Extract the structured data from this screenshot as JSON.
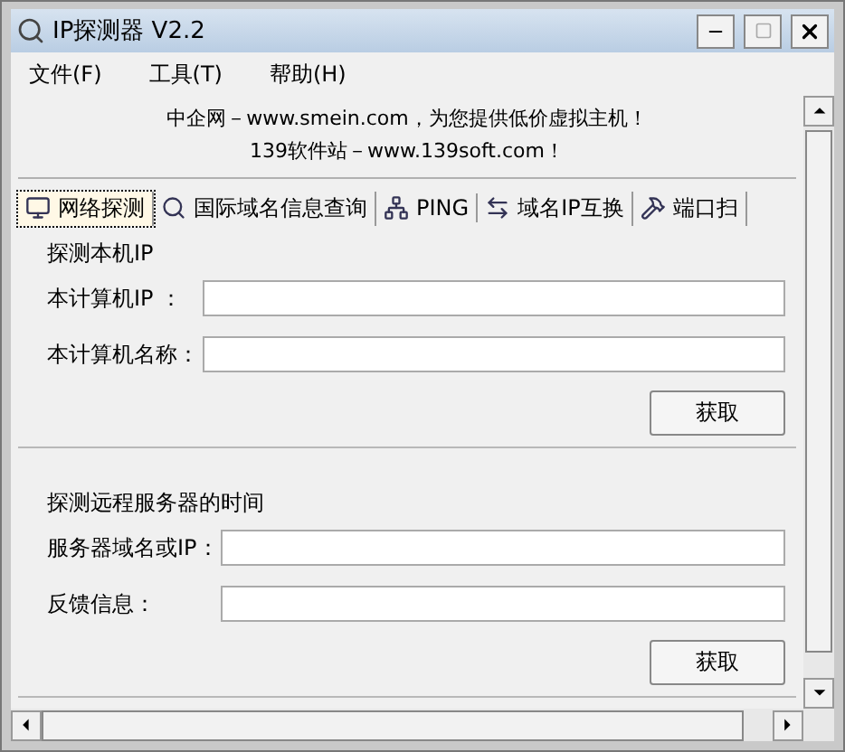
{
  "window": {
    "title": "IP探测器 V2.2"
  },
  "menu": [
    "文件(F)",
    "工具(T)",
    "帮助(H)"
  ],
  "banner": [
    "中企网－www.smein.com，为您提供低价虚拟主机！",
    "139软件站－www.139soft.com！"
  ],
  "tabs": [
    {
      "label": "网络探测",
      "selected": true
    },
    {
      "label": "国际域名信息查询",
      "selected": false
    },
    {
      "label": "PING",
      "selected": false
    },
    {
      "label": "域名IP互换",
      "selected": false
    },
    {
      "label": "端口扫",
      "selected": false
    }
  ],
  "groups": [
    {
      "title": "探测本机IP",
      "fields": [
        {
          "label": "本计算机IP ："
        },
        {
          "label": "本计算机名称："
        }
      ],
      "button": "获取"
    },
    {
      "title": "探测远程服务器的时间",
      "fields": [
        {
          "label": "服务器域名或IP："
        },
        {
          "label": "反馈信息："
        }
      ],
      "button": "获取"
    }
  ]
}
